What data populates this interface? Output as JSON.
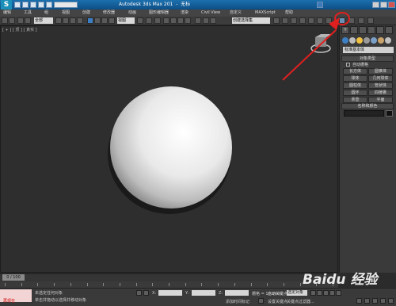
{
  "window": {
    "title": "Autodesk 3ds Max 201",
    "title_suffix": "无标",
    "logo": "S"
  },
  "menu": [
    "编辑",
    "工具",
    "组",
    "视图",
    "创建",
    "修改器",
    "动画",
    "图形编辑器",
    "渲染",
    "Civil View",
    "自定义",
    "MAXScript",
    "帮助"
  ],
  "toolbar": {
    "selection_filter": "全部",
    "reference_coord": "视图",
    "named_selection": "创建选择集",
    "highlighted_tool": "render-setup-icon"
  },
  "viewport": {
    "label": "[ + ] [ 顶 ] [ 真实 ]",
    "background": "#2e2e2e",
    "object": "sphere"
  },
  "command_panel": {
    "tabs": [
      "create-icon",
      "modify-icon",
      "hierarchy-icon",
      "motion-icon",
      "display-icon",
      "utilities-icon"
    ],
    "category_icons": [
      "geometry-icon",
      "shapes-icon",
      "lights-icon",
      "cameras-icon",
      "helpers-icon",
      "spacewarps-icon",
      "systems-icon"
    ],
    "dropdown": "标准基本体",
    "object_type_header": "对象类型",
    "autogrid_label": "自动栅格",
    "primitives": [
      "长方体",
      "圆锥体",
      "球体",
      "几何球体",
      "圆柱体",
      "管状体",
      "圆环",
      "四棱锥",
      "茶壶",
      "平面"
    ],
    "name_color_header": "名称和颜色",
    "color_swatch": "#111111"
  },
  "timeline": {
    "slider_label": "0 / 100",
    "ticks": [
      "0",
      "5",
      "10",
      "15",
      "20",
      "25",
      "30",
      "35",
      "40",
      "45",
      "50",
      "55",
      "60",
      "65",
      "70",
      "75",
      "80",
      "85",
      "90",
      "95",
      "100"
    ]
  },
  "status": {
    "maxscript_label": "再现在",
    "message_1": "未选定任何对象",
    "message_2": "单击并拖动以选择并移动对象",
    "x_label": "X:",
    "y_label": "Y:",
    "z_label": "Z:",
    "grid_label": "栅格 = 10.0mm",
    "add_time_tag": "添加时间标记",
    "auto_key": "自动关键点",
    "auto_key_value": "选定对象",
    "set_key": "设置关键点",
    "key_filters": "关键点过滤器..."
  },
  "watermark": "Baidu 经验",
  "colors": {
    "title_bar": "#1b6fae",
    "accent_blue": "#3d7fc4",
    "annotation_red": "#e02020"
  }
}
